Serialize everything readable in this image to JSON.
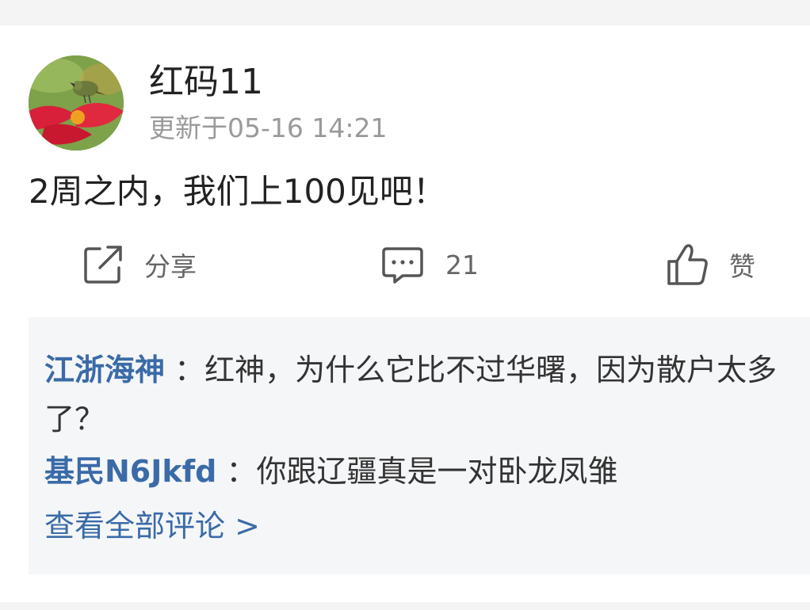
{
  "post": {
    "author": "红码11",
    "updated": "更新于05-16 14:21",
    "content": "2周之内，我们上100见吧！"
  },
  "actions": {
    "share_label": "分享",
    "comment_count": "21",
    "like_label": "赞"
  },
  "comments": [
    {
      "user": "江浙海神",
      "text": "：红神，为什么它比不过华曙，因为散户太多了？"
    },
    {
      "user": "基民N6Jkfd",
      "text": "：你跟辽疆真是一对卧龙凤雏"
    }
  ],
  "view_all_label": "查看全部评论 >",
  "icons": {
    "share": "share-icon",
    "comment": "comment-icon",
    "like": "thumbs-up-icon",
    "avatar": "avatar-bird-flower"
  },
  "colors": {
    "link_blue": "#3a6ba8",
    "muted_gray": "#9a9a9a",
    "panel_bg": "#f5f6f8"
  }
}
